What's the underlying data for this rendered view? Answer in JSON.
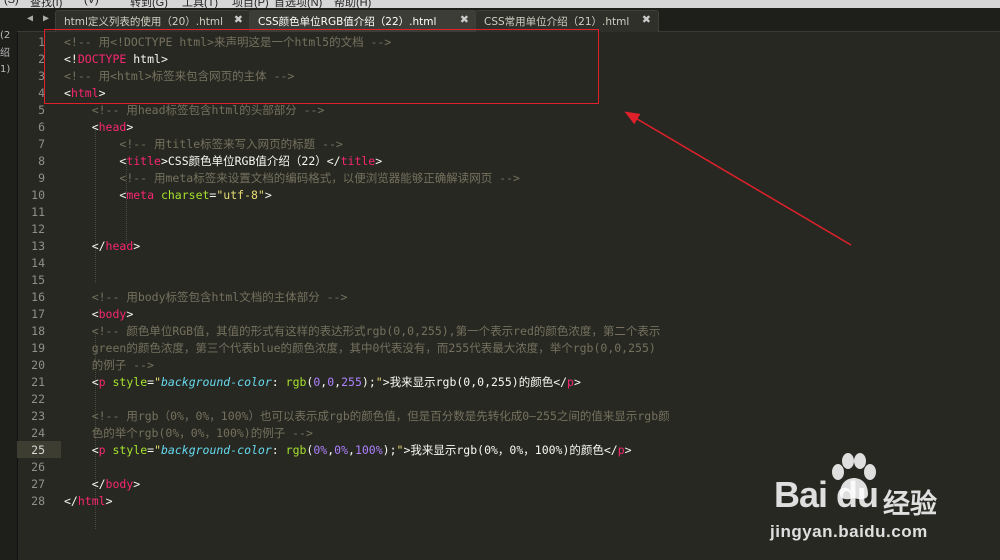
{
  "menubar": {
    "items": [
      "(S)",
      "查找(I)",
      "(V)",
      "转到(G)",
      "工具(T)",
      "项目(P)",
      "首选项(N)",
      "帮助(H)"
    ]
  },
  "side_panel": {
    "fragments": [
      "(2",
      "绍",
      "1)"
    ]
  },
  "tabs": [
    {
      "label": "html定义列表的使用（20）.html",
      "active": false
    },
    {
      "label": "CSS颜色单位RGB值介绍（22）.html",
      "active": true
    },
    {
      "label": "CSS常用单位介绍（21）.html",
      "active": false
    }
  ],
  "tab_close_glyph": "✖",
  "tab_nav": {
    "prev": "◀",
    "next": "▶"
  },
  "current_line": 25,
  "lines": [
    {
      "n": "1",
      "tokens": [
        [
          "c",
          "<!-- 用<!DOCTYPE html>来声明这是一个html5的文档 -->"
        ]
      ]
    },
    {
      "n": "2",
      "tokens": [
        [
          "w",
          "<!"
        ],
        [
          "t",
          "DOCTYPE"
        ],
        [
          "w",
          " html>"
        ]
      ]
    },
    {
      "n": "3",
      "tokens": [
        [
          "c",
          "<!-- 用<html>标签来包含网页的主体 -->"
        ]
      ]
    },
    {
      "n": "4",
      "tokens": [
        [
          "w",
          "<"
        ],
        [
          "t",
          "html"
        ],
        [
          "w",
          ">"
        ]
      ]
    },
    {
      "n": "5",
      "tokens": [
        [
          "w",
          "    "
        ],
        [
          "c",
          "<!-- 用head标签包含html的头部部分 -->"
        ]
      ]
    },
    {
      "n": "6",
      "tokens": [
        [
          "w",
          "    <"
        ],
        [
          "t",
          "head"
        ],
        [
          "w",
          ">"
        ]
      ]
    },
    {
      "n": "7",
      "tokens": [
        [
          "w",
          "        "
        ],
        [
          "c",
          "<!-- 用title标签来写入网页的标题 -->"
        ]
      ]
    },
    {
      "n": "8",
      "tokens": [
        [
          "w",
          "        <"
        ],
        [
          "t",
          "title"
        ],
        [
          "w",
          ">CSS颜色单位RGB值介绍（22）</"
        ],
        [
          "t",
          "title"
        ],
        [
          "w",
          ">"
        ]
      ]
    },
    {
      "n": "9",
      "tokens": [
        [
          "w",
          "        "
        ],
        [
          "c",
          "<!-- 用meta标签来设置文档的编码格式，以便浏览器能够正确解读网页 -->"
        ]
      ]
    },
    {
      "n": "10",
      "tokens": [
        [
          "w",
          "        <"
        ],
        [
          "t",
          "meta"
        ],
        [
          "w",
          " "
        ],
        [
          "a",
          "charset"
        ],
        [
          "w",
          "="
        ],
        [
          "s",
          "\"utf-8\""
        ],
        [
          "w",
          ">"
        ]
      ]
    },
    {
      "n": "11",
      "tokens": []
    },
    {
      "n": "12",
      "tokens": []
    },
    {
      "n": "13",
      "tokens": [
        [
          "w",
          "    </"
        ],
        [
          "t",
          "head"
        ],
        [
          "w",
          ">"
        ]
      ]
    },
    {
      "n": "14",
      "tokens": []
    },
    {
      "n": "15",
      "tokens": []
    },
    {
      "n": "16",
      "tokens": [
        [
          "w",
          "    "
        ],
        [
          "c",
          "<!-- 用body标签包含html文档的主体部分 -->"
        ]
      ]
    },
    {
      "n": "17",
      "tokens": [
        [
          "w",
          "    <"
        ],
        [
          "t",
          "body"
        ],
        [
          "w",
          ">"
        ]
      ]
    },
    {
      "n": "18",
      "tokens": [
        [
          "w",
          "    "
        ],
        [
          "c",
          "<!-- 颜色单位RGB值，其值的形式有这样的表达形式rgb(0,0,255),第一个表示red的颜色浓度，第二个表示"
        ]
      ]
    },
    {
      "n": "19",
      "tokens": [
        [
          "w",
          "    "
        ],
        [
          "c",
          "green的颜色浓度，第三个代表blue的颜色浓度，其中0代表没有，而255代表最大浓度，举个rgb(0,0,255)"
        ]
      ]
    },
    {
      "n": "20",
      "tokens": [
        [
          "w",
          "    "
        ],
        [
          "c",
          "的例子 -->"
        ]
      ]
    },
    {
      "n": "21",
      "tokens": [
        [
          "w",
          "    <"
        ],
        [
          "t",
          "p"
        ],
        [
          "w",
          " "
        ],
        [
          "a",
          "style"
        ],
        [
          "w",
          "="
        ],
        [
          "s",
          "\""
        ],
        [
          "i",
          "background-color"
        ],
        [
          "w",
          ": "
        ],
        [
          "a",
          "rgb"
        ],
        [
          "w",
          "("
        ],
        [
          "n",
          "0"
        ],
        [
          "w",
          ","
        ],
        [
          "n",
          "0"
        ],
        [
          "w",
          ","
        ],
        [
          "n",
          "255"
        ],
        [
          "w",
          ");"
        ],
        [
          "s",
          "\""
        ],
        [
          "w",
          ">我来显示rgb(0,0,255)的颜色</"
        ],
        [
          "t",
          "p"
        ],
        [
          "w",
          ">"
        ]
      ]
    },
    {
      "n": "22",
      "tokens": []
    },
    {
      "n": "23",
      "tokens": [
        [
          "w",
          "    "
        ],
        [
          "c",
          "<!-- 用rgb（0%，0%，100%）也可以表示成rgb的颜色值，但是百分数是先转化成0—255之间的值来显示rgb颜"
        ]
      ]
    },
    {
      "n": "24",
      "tokens": [
        [
          "w",
          "    "
        ],
        [
          "c",
          "色的举个rgb(0%，0%，100%)的例子 -->"
        ]
      ]
    },
    {
      "n": "25",
      "tokens": [
        [
          "w",
          "    <"
        ],
        [
          "t",
          "p"
        ],
        [
          "w",
          " "
        ],
        [
          "a",
          "style"
        ],
        [
          "w",
          "="
        ],
        [
          "s",
          "\""
        ],
        [
          "i",
          "background-color"
        ],
        [
          "w",
          ": "
        ],
        [
          "a",
          "rgb"
        ],
        [
          "w",
          "("
        ],
        [
          "n",
          "0%"
        ],
        [
          "w",
          ","
        ],
        [
          "n",
          "0%"
        ],
        [
          "w",
          ","
        ],
        [
          "n",
          "100%"
        ],
        [
          "w",
          ");"
        ],
        [
          "s",
          "\""
        ],
        [
          "w",
          ">我来显示rgb(0%，0%，100%)的颜色</"
        ],
        [
          "t",
          "p"
        ],
        [
          "w",
          ">"
        ]
      ]
    },
    {
      "n": "26",
      "tokens": []
    },
    {
      "n": "27",
      "tokens": [
        [
          "w",
          "    </"
        ],
        [
          "t",
          "body"
        ],
        [
          "w",
          ">"
        ]
      ]
    },
    {
      "n": "28",
      "tokens": [
        [
          "w",
          "</"
        ],
        [
          "t",
          "html"
        ],
        [
          "w",
          ">"
        ]
      ]
    }
  ],
  "annotation": {
    "color": "#e0202a"
  },
  "watermark": {
    "logo": "Bai du",
    "brand_cn": "经验",
    "url": "jingyan.baidu.com"
  },
  "colors": {
    "background": "#272822",
    "comment": "#75715e",
    "tag": "#f92672",
    "attr": "#a6e22e",
    "string": "#e6db74",
    "number": "#ae81ff",
    "property": "#66d9ef"
  }
}
